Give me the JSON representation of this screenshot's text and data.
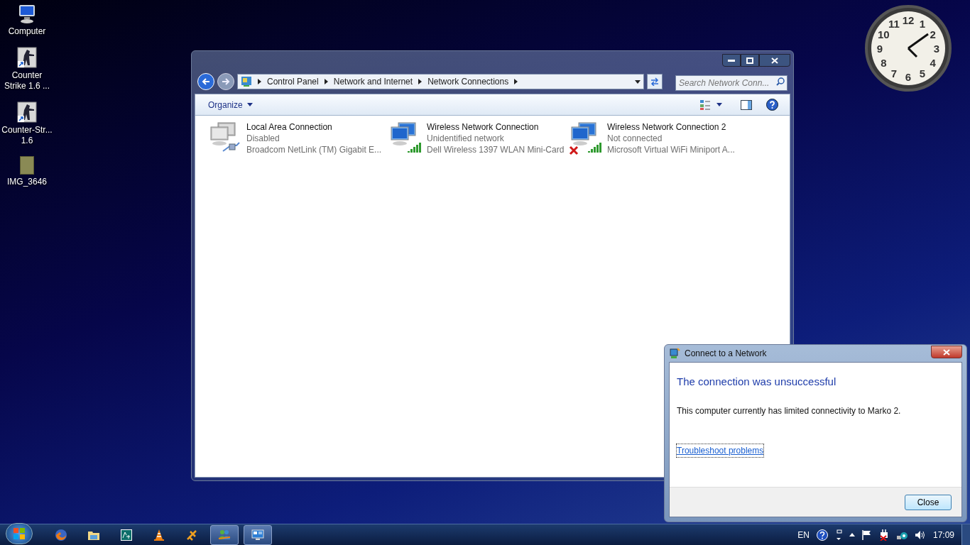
{
  "desktop_icons": [
    {
      "label": "Computer",
      "kind": "computer"
    },
    {
      "label": "Counter Strike 1.6 ...",
      "kind": "shortcut"
    },
    {
      "label": "Counter-Str... 1.6",
      "kind": "shortcut"
    },
    {
      "label": "IMG_3646",
      "kind": "image"
    }
  ],
  "clock": {
    "numbers": [
      "12",
      "11",
      "1",
      "10",
      "2",
      "9",
      "3",
      "8",
      "4",
      "7",
      "5",
      "6"
    ]
  },
  "explorer": {
    "breadcrumb": [
      "Control Panel",
      "Network and Internet",
      "Network Connections"
    ],
    "search": {
      "placeholder": "Search Network Conn..."
    },
    "organize": "Organize",
    "connections": [
      {
        "name": "Local Area Connection",
        "status": "Disabled",
        "adapter": "Broadcom NetLink (TM) Gigabit E...",
        "kind": "wired",
        "error": false
      },
      {
        "name": "Wireless Network Connection",
        "status": "Unidentified network",
        "adapter": "Dell Wireless 1397 WLAN Mini-Card",
        "kind": "wireless",
        "error": false
      },
      {
        "name": "Wireless Network Connection 2",
        "status": "Not connected",
        "adapter": "Microsoft Virtual WiFi Miniport A...",
        "kind": "wireless",
        "error": true
      }
    ]
  },
  "dialog": {
    "title": "Connect to a Network",
    "heading": "The connection was unsuccessful",
    "message": "This computer currently has limited connectivity to Marko 2.",
    "link": "Troubleshoot problems",
    "button": "Close"
  },
  "taskbar": {
    "apps": [
      {
        "kind": "firefox",
        "open": false
      },
      {
        "kind": "folder",
        "open": false
      },
      {
        "kind": "diagram",
        "open": false
      },
      {
        "kind": "cone",
        "open": false
      },
      {
        "kind": "tool",
        "open": false
      },
      {
        "kind": "people",
        "open": true
      },
      {
        "kind": "monitor",
        "open": true
      }
    ],
    "language": "EN",
    "time": "17:09"
  }
}
